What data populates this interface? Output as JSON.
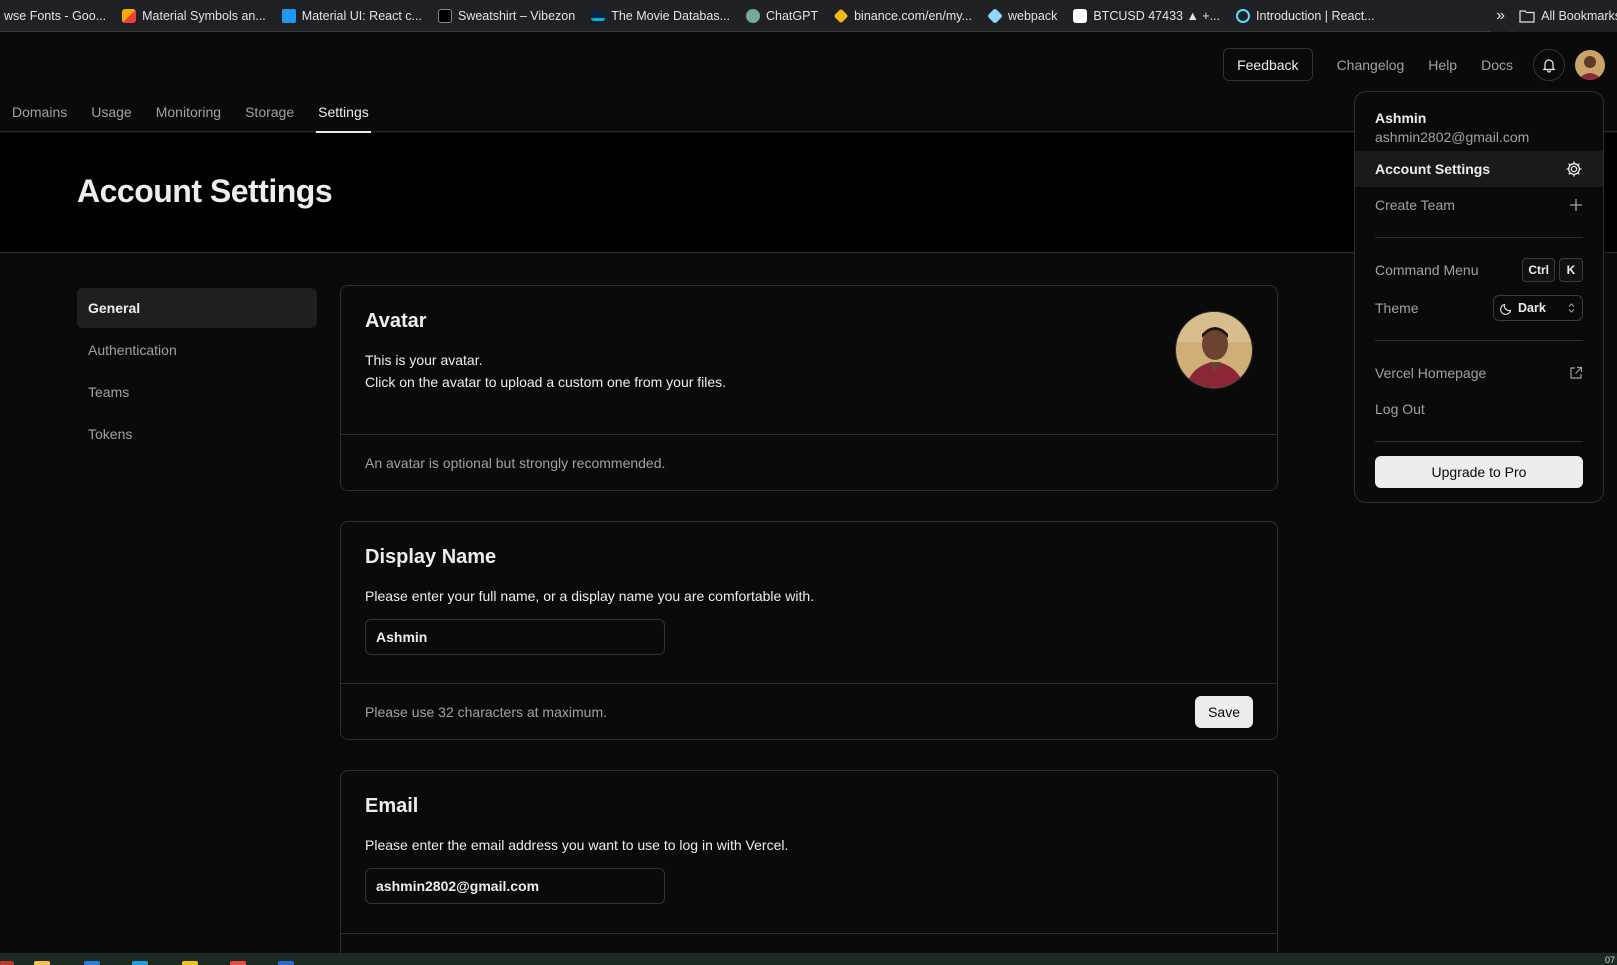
{
  "bookmarks": [
    {
      "label": "wse Fonts - Goo...",
      "icon": "google-fonts-icon",
      "color": "#4285f4"
    },
    {
      "label": "Material Symbols an...",
      "icon": "material-symbols-icon",
      "color": "#f9ab00"
    },
    {
      "label": "Material UI: React c...",
      "icon": "mui-icon",
      "color": "#2196f3"
    },
    {
      "label": "Sweatshirt – Vibezon",
      "icon": "vibezon-icon",
      "color": "#000000"
    },
    {
      "label": "The Movie Databas...",
      "icon": "tmdb-icon",
      "color": "#01b4e4"
    },
    {
      "label": "ChatGPT",
      "icon": "chatgpt-icon",
      "color": "#74aa9c"
    },
    {
      "label": "binance.com/en/my...",
      "icon": "binance-icon",
      "color": "#f0b90b"
    },
    {
      "label": "webpack",
      "icon": "webpack-icon",
      "color": "#8ed6fb"
    },
    {
      "label": "BTCUSD 47433 ▲ +...",
      "icon": "tradingview-icon",
      "color": "#ffffff"
    },
    {
      "label": "Introduction | React...",
      "icon": "react-icon",
      "color": "#61dafb"
    }
  ],
  "bookmarks_more": "»",
  "bookmarks_all": "All Bookmarks",
  "header": {
    "feedback": "Feedback",
    "changelog": "Changelog",
    "help": "Help",
    "docs": "Docs"
  },
  "tabs": [
    {
      "label": "Domains",
      "active": false
    },
    {
      "label": "Usage",
      "active": false
    },
    {
      "label": "Monitoring",
      "active": false
    },
    {
      "label": "Storage",
      "active": false
    },
    {
      "label": "Settings",
      "active": true
    }
  ],
  "page_title": "Account Settings",
  "sidebar": {
    "items": [
      {
        "label": "General",
        "active": true
      },
      {
        "label": "Authentication",
        "active": false
      },
      {
        "label": "Teams",
        "active": false
      },
      {
        "label": "Tokens",
        "active": false
      }
    ]
  },
  "avatar_card": {
    "title": "Avatar",
    "desc_line1": "This is your avatar.",
    "desc_line2": "Click on the avatar to upload a custom one from your files.",
    "footer": "An avatar is optional but strongly recommended."
  },
  "display_name_card": {
    "title": "Display Name",
    "desc": "Please enter your full name, or a display name you are comfortable with.",
    "value": "Ashmin",
    "footer": "Please use 32 characters at maximum.",
    "save": "Save"
  },
  "email_card": {
    "title": "Email",
    "desc": "Please enter the email address you want to use to log in with Vercel.",
    "value": "ashmin2802@gmail.com"
  },
  "menu": {
    "name": "Ashmin",
    "email": "ashmin2802@gmail.com",
    "account_settings": "Account Settings",
    "create_team": "Create Team",
    "command_menu": "Command Menu",
    "kbd_ctrl": "Ctrl",
    "kbd_k": "K",
    "theme": "Theme",
    "theme_value": "Dark",
    "homepage": "Vercel Homepage",
    "logout": "Log Out",
    "upgrade": "Upgrade to Pro"
  },
  "taskbar": {
    "clock": "07"
  },
  "colors": {
    "background": "#0a0a0a",
    "hero": "#000000",
    "border": "#2e2e2e",
    "text": "#ededed",
    "muted": "#a1a1a1"
  }
}
